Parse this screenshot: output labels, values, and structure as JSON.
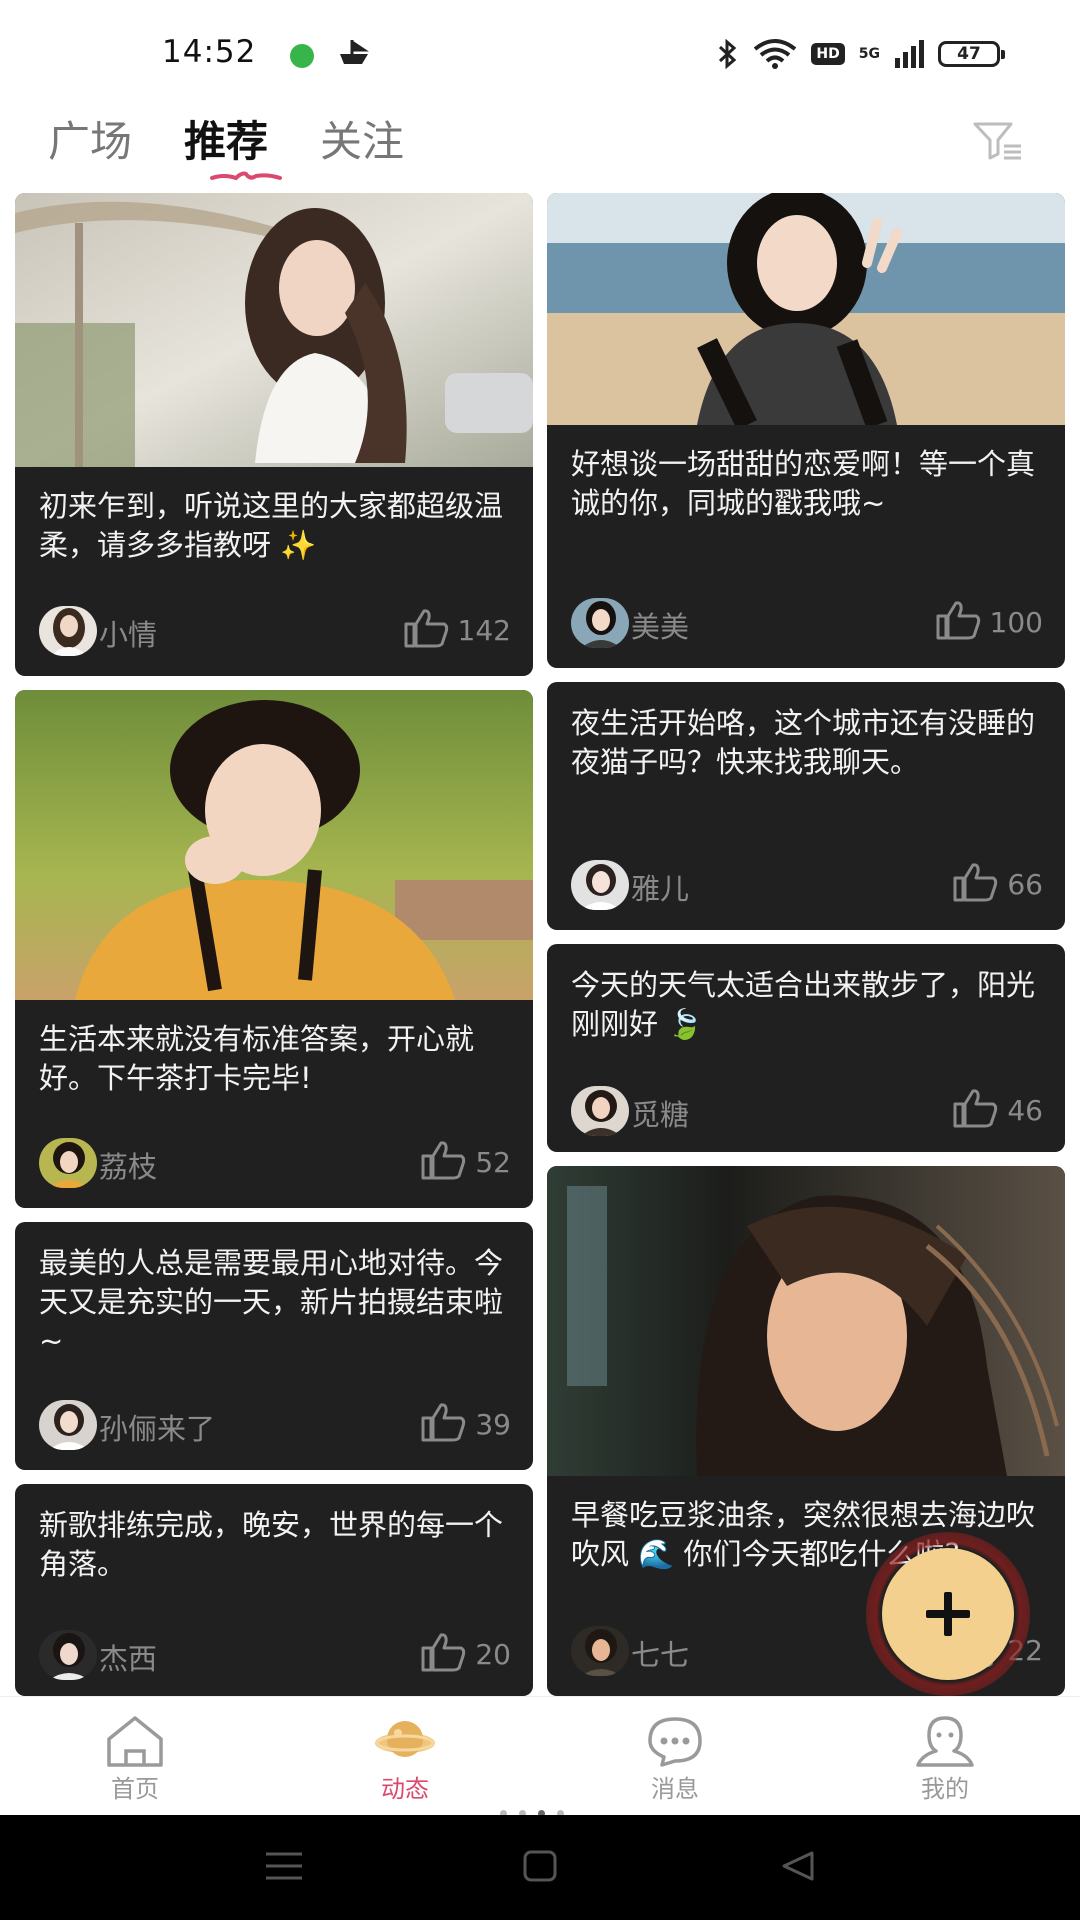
{
  "status_bar": {
    "time": "14:52",
    "battery": "47",
    "network": "5G",
    "hd": "HD"
  },
  "tabs": [
    {
      "label": "广场",
      "active": false
    },
    {
      "label": "推荐",
      "active": true
    },
    {
      "label": "关注",
      "active": false
    }
  ],
  "posts": [
    {
      "text": "初来乍到，听说这里的大家都超级温柔，请多多指教呀 ✨",
      "author": "小情",
      "likes": "142"
    },
    {
      "text": "好想谈一场甜甜的恋爱啊！等一个真诚的你，同城的戳我哦~",
      "author": "美美",
      "likes": "100"
    },
    {
      "text": "生活本来就没有标准答案，开心就好。下午茶打卡完毕!",
      "author": "荔枝",
      "likes": "52"
    },
    {
      "text": "夜生活开始咯，这个城市还有没睡的夜猫子吗？快来找我聊天。",
      "author": "雅儿",
      "likes": "66"
    },
    {
      "text": "最美的人总是需要最用心地对待。今天又是充实的一天，新片拍摄结束啦~",
      "author": "孙俪来了",
      "likes": "39"
    },
    {
      "text": "今天的天气太适合出来散步了，阳光刚刚好 🍃",
      "author": "觅糖",
      "likes": "46"
    },
    {
      "text": "新歌排练完成，晚安，世界的每一个角落。",
      "author": "杰西",
      "likes": "20"
    },
    {
      "text": "早餐吃豆浆油条，突然很想去海边吹吹风 🌊 你们今天都吃什么啦?",
      "author": "七七",
      "likes": "22"
    }
  ],
  "bottom_nav": [
    {
      "label": "首页",
      "icon": "home-icon",
      "active": false
    },
    {
      "label": "动态",
      "icon": "planet-icon",
      "active": true
    },
    {
      "label": "消息",
      "icon": "chat-bubble-icon",
      "active": false
    },
    {
      "label": "我的",
      "icon": "person-icon",
      "active": false
    }
  ],
  "colors": {
    "card_bg": "#202020",
    "accent": "#d94a6e",
    "fab": "#f4d08e"
  }
}
